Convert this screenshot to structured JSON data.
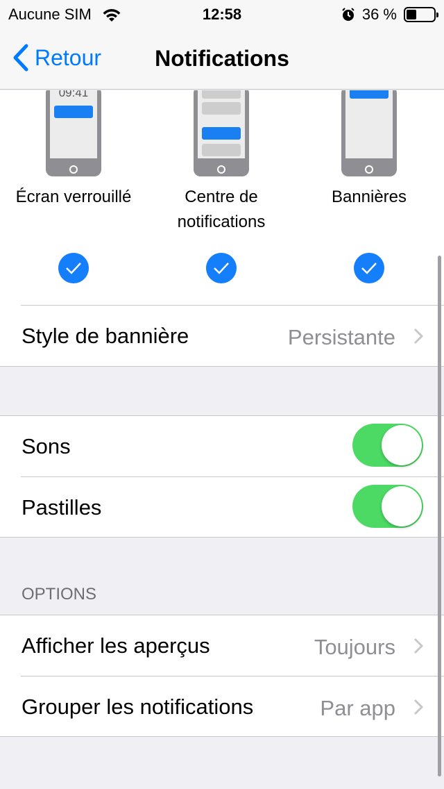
{
  "status_bar": {
    "carrier": "Aucune SIM",
    "time": "12:58",
    "battery_percent": "36 %",
    "battery_level": 0.36
  },
  "nav": {
    "back_label": "Retour",
    "title": "Notifications"
  },
  "alert_styles": [
    {
      "label_line1": "Écran verrouillé",
      "label_line2": "",
      "checked": true,
      "preview_time": "09:41"
    },
    {
      "label_line1": "Centre de",
      "label_line2": "notifications",
      "checked": true
    },
    {
      "label_line1": "Bannières",
      "label_line2": "",
      "checked": true
    }
  ],
  "banner_style": {
    "label": "Style de bannière",
    "value": "Persistante"
  },
  "toggles": [
    {
      "label": "Sons",
      "on": true
    },
    {
      "label": "Pastilles",
      "on": true
    }
  ],
  "options": {
    "header": "OPTIONS",
    "rows": [
      {
        "label": "Afficher les aperçus",
        "value": "Toujours"
      },
      {
        "label": "Grouper les notifications",
        "value": "Par app"
      }
    ]
  },
  "colors": {
    "accent": "#007aff",
    "check": "#147efb",
    "toggle_on": "#4cd964"
  }
}
